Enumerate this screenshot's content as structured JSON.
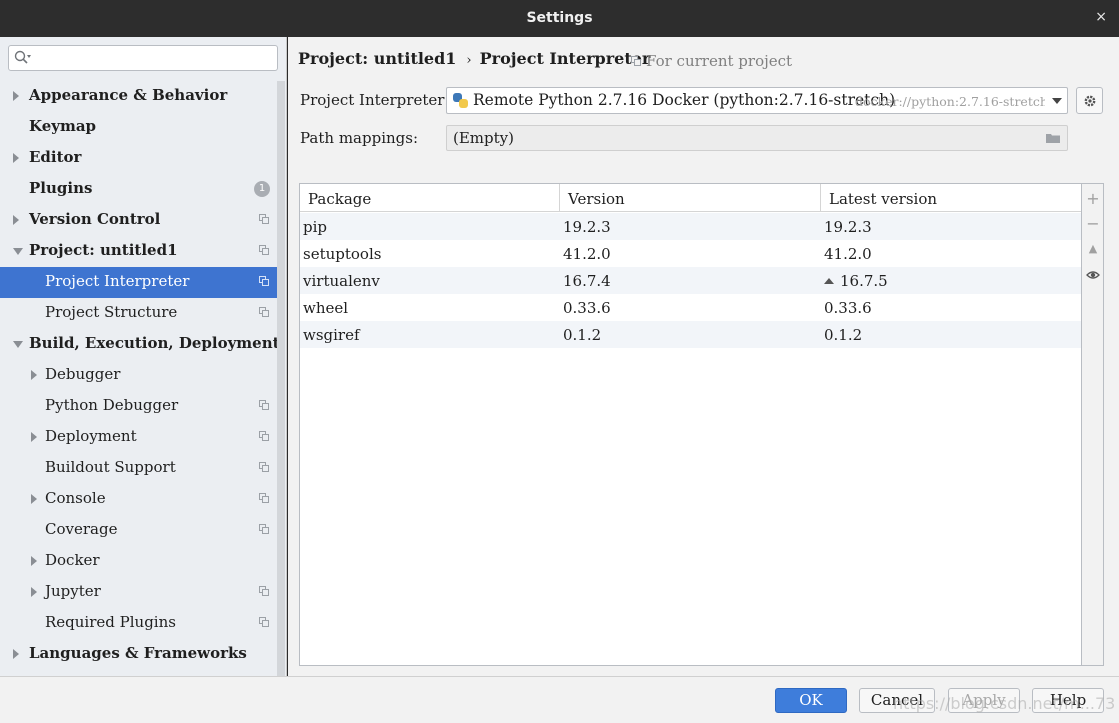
{
  "window": {
    "title": "Settings",
    "close_glyph": "×"
  },
  "search": {
    "placeholder": "",
    "value": ""
  },
  "sidebar": {
    "items": [
      {
        "label": "Appearance & Behavior",
        "level": 0,
        "arrow": "right"
      },
      {
        "label": "Keymap",
        "level": 0
      },
      {
        "label": "Editor",
        "level": 0,
        "arrow": "right"
      },
      {
        "label": "Plugins",
        "level": 0,
        "badge": "1"
      },
      {
        "label": "Version Control",
        "level": 0,
        "arrow": "right",
        "copy": true
      },
      {
        "label": "Project: untitled1",
        "level": 0,
        "arrow": "down",
        "copy": true
      },
      {
        "label": "Project Interpreter",
        "level": 1,
        "copy": true,
        "selected": true
      },
      {
        "label": "Project Structure",
        "level": 1,
        "copy": true
      },
      {
        "label": "Build, Execution, Deployment",
        "level": 0,
        "arrow": "down"
      },
      {
        "label": "Debugger",
        "level": 1,
        "arrow": "right"
      },
      {
        "label": "Python Debugger",
        "level": 1,
        "copy": true
      },
      {
        "label": "Deployment",
        "level": 1,
        "arrow": "right",
        "copy": true
      },
      {
        "label": "Buildout Support",
        "level": 1,
        "copy": true
      },
      {
        "label": "Console",
        "level": 1,
        "arrow": "right",
        "copy": true
      },
      {
        "label": "Coverage",
        "level": 1,
        "copy": true
      },
      {
        "label": "Docker",
        "level": 1,
        "arrow": "right"
      },
      {
        "label": "Jupyter",
        "level": 1,
        "arrow": "right",
        "copy": true
      },
      {
        "label": "Required Plugins",
        "level": 1,
        "copy": true
      },
      {
        "label": "Languages & Frameworks",
        "level": 0,
        "arrow": "right"
      }
    ]
  },
  "main": {
    "breadcrumb": {
      "parent": "Project: untitled1",
      "separator": "›",
      "current": "Project Interpreter"
    },
    "scope_note": "For current project",
    "interpreter": {
      "label": "Project Interpreter:",
      "name": "Remote Python 2.7.16 Docker (python:2.7.16-stretch)",
      "path": "docker://python:2.7.16-stretch/"
    },
    "path_mappings": {
      "label": "Path mappings:",
      "value": "(Empty)"
    },
    "table": {
      "columns": [
        "Package",
        "Version",
        "Latest version"
      ],
      "rows": [
        {
          "package": "pip",
          "version": "19.2.3",
          "latest": "19.2.3",
          "upgrade": false
        },
        {
          "package": "setuptools",
          "version": "41.2.0",
          "latest": "41.2.0",
          "upgrade": false
        },
        {
          "package": "virtualenv",
          "version": "16.7.4",
          "latest": "16.7.5",
          "upgrade": true
        },
        {
          "package": "wheel",
          "version": "0.33.6",
          "latest": "0.33.6",
          "upgrade": false
        },
        {
          "package": "wsgiref",
          "version": "0.1.2",
          "latest": "0.1.2",
          "upgrade": false
        }
      ]
    },
    "tools": {
      "add": "+",
      "remove": "−",
      "upgrade": "▲",
      "show": "eye-icon"
    }
  },
  "footer": {
    "ok": "OK",
    "cancel": "Cancel",
    "apply": "Apply",
    "help": "Help",
    "watermark": "https://blog.csdn.net/m...73"
  },
  "colors": {
    "accent": "#3e74d0",
    "ok_button": "#3e7ddb",
    "sidebar_bg": "#ebeef2"
  }
}
